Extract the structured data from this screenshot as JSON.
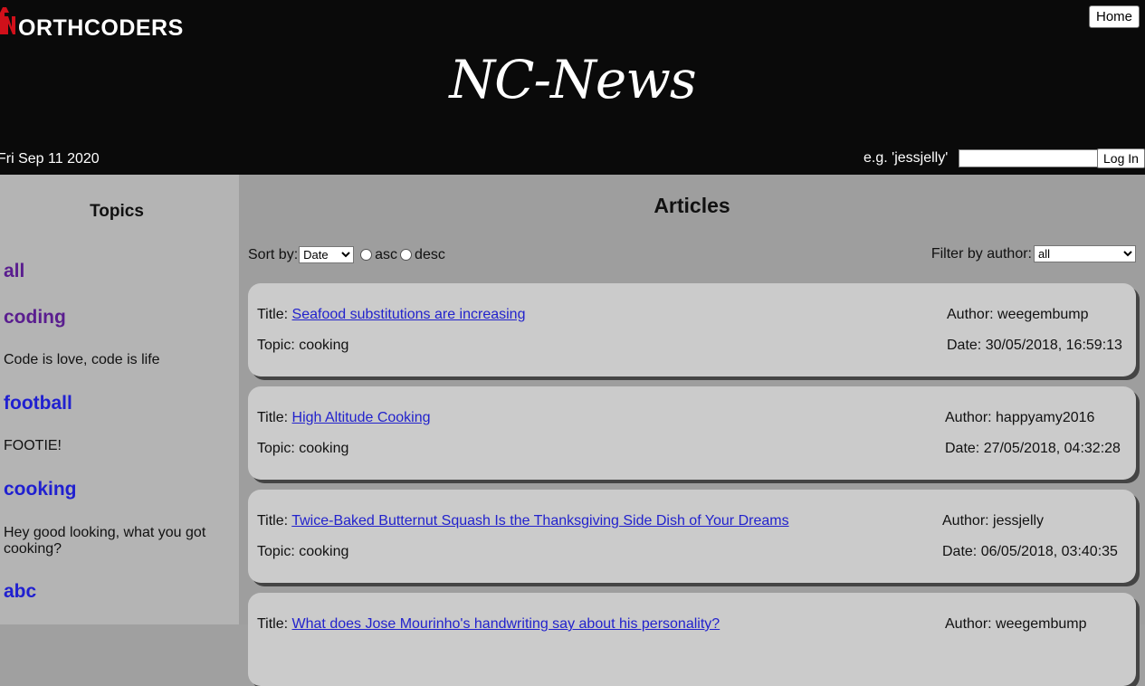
{
  "header": {
    "logo_text": "ORTHCODERS",
    "logo_letter": "N",
    "home_label": "Home",
    "site_title": "NC-News",
    "date": "Fri Sep 11 2020",
    "login_hint": "e.g. 'jessjelly'",
    "login_value": "",
    "login_label": "Log In"
  },
  "sidebar": {
    "heading": "Topics",
    "topics": [
      {
        "name": "all",
        "description": "",
        "color": "#5a1d8f"
      },
      {
        "name": "coding",
        "description": "Code is love, code is life",
        "color": "#5a1d8f"
      },
      {
        "name": "football",
        "description": "FOOTIE!",
        "color": "#2020d0"
      },
      {
        "name": "cooking",
        "description": "Hey good looking, what you got cooking?",
        "color": "#2020d0"
      },
      {
        "name": "abc",
        "description": "",
        "color": "#2020d0"
      }
    ]
  },
  "main": {
    "heading": "Articles",
    "sort_label": "Sort by:",
    "sort_value": "Date",
    "asc_label": "asc",
    "desc_label": "desc",
    "filter_label": "Filter by author:",
    "filter_value": "all",
    "articles": [
      {
        "title_prefix": "Title:",
        "title": "Seafood substitutions are increasing",
        "topic": "Topic: cooking",
        "author": "Author: weegembump",
        "date": "Date: 30/05/2018, 16:59:13"
      },
      {
        "title_prefix": "Title:",
        "title": "High Altitude Cooking",
        "topic": "Topic: cooking",
        "author": "Author: happyamy2016",
        "date": "Date: 27/05/2018, 04:32:28"
      },
      {
        "title_prefix": "Title:",
        "title": "Twice-Baked Butternut Squash Is the Thanksgiving Side Dish of Your Dreams",
        "topic": "Topic: cooking",
        "author": "Author: jessjelly",
        "date": "Date: 06/05/2018, 03:40:35"
      },
      {
        "title_prefix": "Title:",
        "title": "What does Jose Mourinho's handwriting say about his personality?",
        "topic": "",
        "author": "Author: weegembump",
        "date": ""
      }
    ]
  },
  "colors": {
    "header_bg": "#0a0a0a",
    "sidebar_bg": "#b4b4b4",
    "main_bg": "#9e9e9e",
    "card_bg": "#cbcbcb",
    "link": "#2222cc",
    "logo_accent": "#d0101a"
  }
}
